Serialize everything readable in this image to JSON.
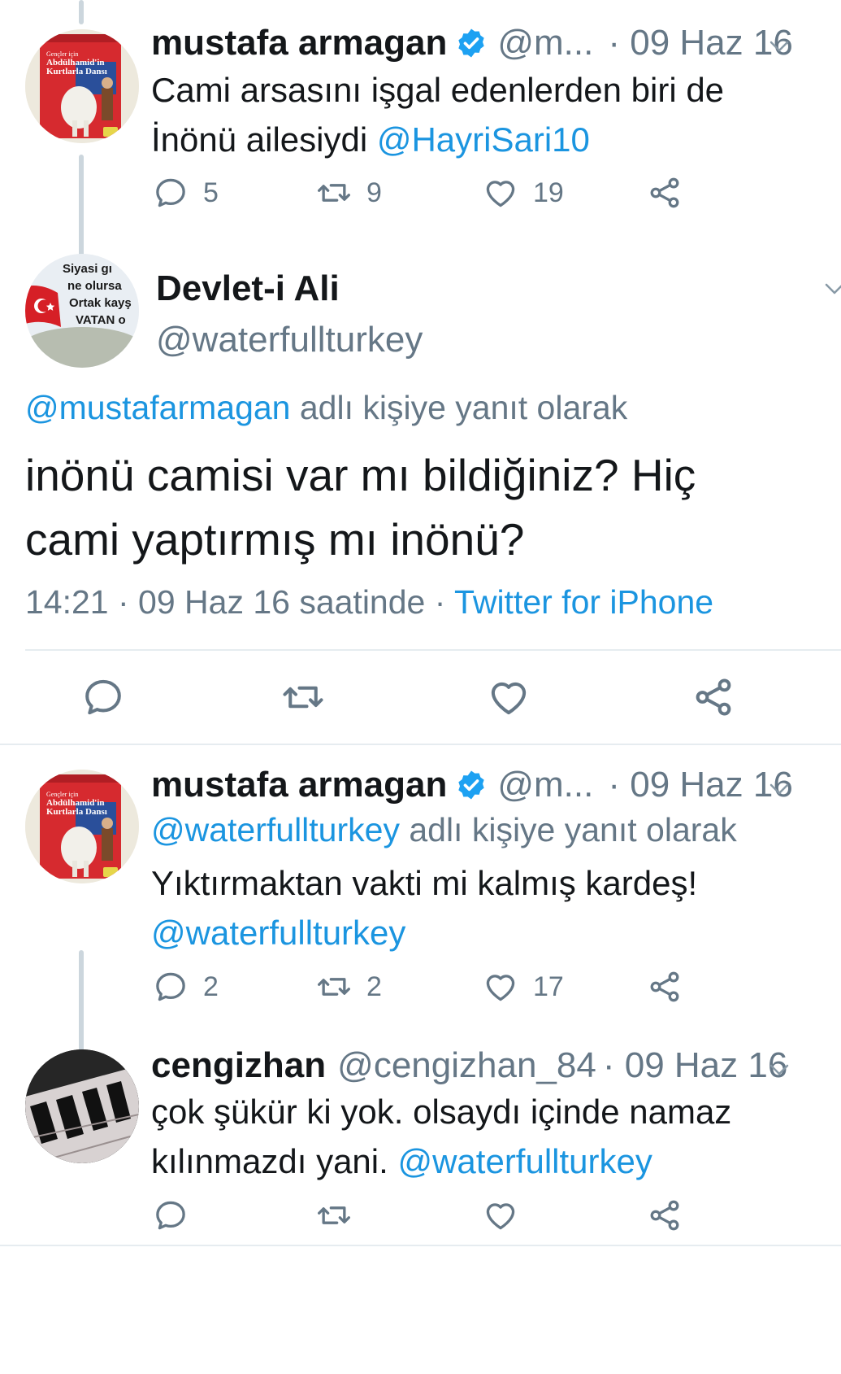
{
  "colors": {
    "link": "#1b95e0",
    "muted": "#657786",
    "text": "#14171a",
    "verified": "#1da1f2"
  },
  "tweet1": {
    "name": "mustafa armagan",
    "handle": "@m...",
    "date": "· 09 Haz 16",
    "text_line1": "Cami arsasını işgal edenlerden biri de",
    "text_line2": "İnönü ailesiydi ",
    "mention": "@HayriSari10",
    "replies": "5",
    "retweets": "9",
    "likes": "19",
    "avatar_book_title": "Abdülhamid'in Kurtlarla Dansı",
    "avatar_book_kicker": "Gençler için"
  },
  "main": {
    "name": "Devlet-i Ali",
    "handle": "@waterfullturkey",
    "avatar_text": [
      "Siyasi gı",
      "ne olursa",
      "Ortak kayş",
      "VATAN o"
    ],
    "reply_to_mention": "@mustafarmagan",
    "reply_to_suffix": " adlı kişiye yanıt olarak",
    "text_line1": "inönü camisi var mı bildiğiniz? Hiç",
    "text_line2": "cami yaptırmış mı inönü?",
    "time": "14:21 · 09 Haz 16 saatinde · ",
    "source": "Twitter for iPhone"
  },
  "tweet3": {
    "name": "mustafa armagan",
    "handle": "@m...",
    "date": "· 09 Haz 16",
    "reply_to_mention": "@waterfullturkey",
    "reply_to_suffix": " adlı kişiye yanıt olarak",
    "text_line1": "Yıktırmaktan vakti mi kalmış kardeş!",
    "mention": "@waterfullturkey",
    "replies": "2",
    "retweets": "2",
    "likes": "17",
    "avatar_book_title": "Abdülhamid'in Kurtlarla Dansı",
    "avatar_book_kicker": "Gençler için"
  },
  "tweet4": {
    "name": "cengizhan",
    "handle": "@cengizhan_84",
    "date": "· 09 Haz 16",
    "text_line1": "çok şükür ki yok. olsaydı içinde namaz",
    "text_line2": "kılınmazdı yani. ",
    "mention": "@waterfullturkey"
  },
  "icons": [
    "reply-icon",
    "retweet-icon",
    "like-icon",
    "share-icon",
    "verified-icon",
    "chevron-down-icon"
  ]
}
